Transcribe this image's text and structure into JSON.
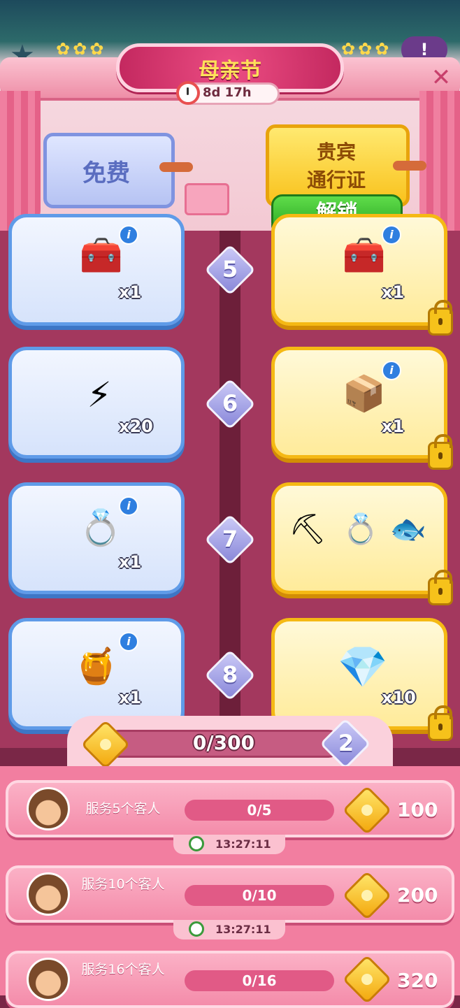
{
  "header": {
    "title": "母亲节",
    "timer": "8d 17h",
    "close_glyph": "✕",
    "chat_glyph": "!"
  },
  "tiers": {
    "free_label": "免费",
    "vip_label_line1": "贵宾",
    "vip_label_line2": "通行证",
    "unlock_button": "解锁"
  },
  "rewards": [
    {
      "level": "5",
      "free": {
        "icon": "treasure-chest-icon",
        "qty": "x1"
      },
      "vip": {
        "icon": "treasure-chest-icon",
        "qty": "x1",
        "locked": true
      }
    },
    {
      "level": "6",
      "free": {
        "icon": "energy-coins-icon",
        "qty": "x20"
      },
      "vip": {
        "icon": "energy-box-icon",
        "qty": "x1",
        "locked": true
      }
    },
    {
      "level": "7",
      "free": {
        "icon": "pearl-ring-icon",
        "qty": "x1"
      },
      "vip": {
        "icon": "tool-ring-fish-icon",
        "qty": "",
        "locked": true
      }
    },
    {
      "level": "8",
      "free": {
        "icon": "honey-jar-icon",
        "qty": "x1"
      },
      "vip": {
        "icon": "purple-gems-icon",
        "qty": "x10",
        "locked": true
      }
    }
  ],
  "progress": {
    "text": "0/300",
    "current": 0,
    "max": 300,
    "current_level": "2"
  },
  "tasks": [
    {
      "label": "服务5个客人",
      "progress": "0/5",
      "reward": "100",
      "timer": "13:27:11"
    },
    {
      "label": "服务10个客人",
      "progress": "0/10",
      "reward": "200",
      "timer": "13:27:11"
    },
    {
      "label": "服务16个客人",
      "progress": "0/16",
      "reward": "320",
      "timer": ""
    }
  ],
  "colors": {
    "accent_pink": "#ec4d83",
    "title_yellow": "#ffe15a",
    "unlock_green": "#2aa722",
    "free_blue": "#5f9be8",
    "vip_gold": "#f5b914"
  }
}
